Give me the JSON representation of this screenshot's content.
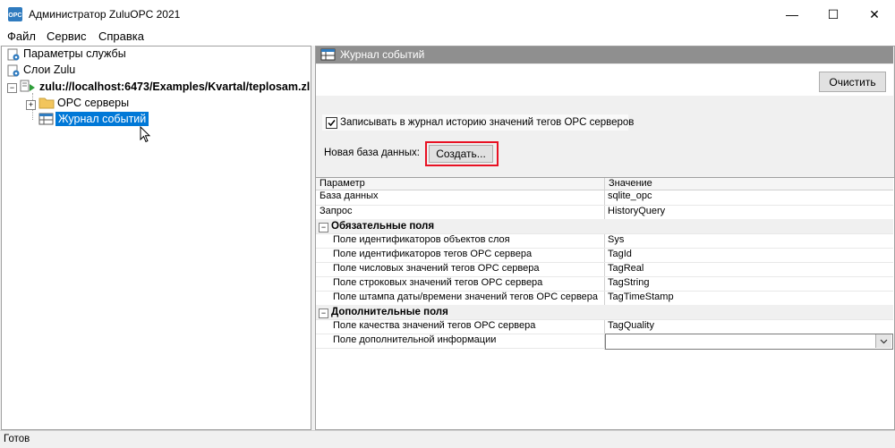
{
  "window": {
    "title": "Администратор ZuluOPC 2021",
    "minimize": "—",
    "maximize": "☐",
    "close": "✕"
  },
  "menu": [
    "Файл",
    "Сервис",
    "Справка"
  ],
  "tree": {
    "service_params": "Параметры службы",
    "zulu_layers": "Слои Zulu",
    "layer_path": "zulu://localhost:6473/Examples/Kvartal/teplosam.zl",
    "opc_servers": "OPC серверы",
    "event_log": "Журнал событий"
  },
  "right": {
    "header_title": "Журнал событий",
    "clear_button": "Очистить",
    "checkbox_label": "Записывать в журнал историю значений тегов OPC серверов",
    "checkbox_checked": true,
    "new_db_label": "Новая база данных:",
    "create_button": "Создать..."
  },
  "grid": {
    "columns": [
      "Параметр",
      "Значение"
    ],
    "rows": [
      {
        "param": "База данных",
        "value": "sqlite_opc"
      },
      {
        "param": "Запрос",
        "value": "HistoryQuery"
      }
    ],
    "group1": {
      "title": "Обязательные поля",
      "rows": [
        {
          "param": "Поле идентификаторов объектов слоя",
          "value": "Sys"
        },
        {
          "param": "Поле идентификаторов тегов OPC сервера",
          "value": "TagId"
        },
        {
          "param": "Поле числовых значений тегов OPC сервера",
          "value": "TagReal"
        },
        {
          "param": "Поле строковых значений тегов OPC сервера",
          "value": "TagString"
        },
        {
          "param": "Поле штампа даты/времени значений тегов OPC сервера",
          "value": "TagTimeStamp"
        }
      ]
    },
    "group2": {
      "title": "Дополнительные поля",
      "rows": [
        {
          "param": "Поле качества значений тегов OPC сервера",
          "value": "TagQuality"
        },
        {
          "param": "Поле дополнительной информации",
          "value": ""
        }
      ]
    }
  },
  "status": "Готов",
  "colors": {
    "selection": "#0078d7",
    "header_bg": "#8f8f8f",
    "highlight_border": "#e81123"
  }
}
